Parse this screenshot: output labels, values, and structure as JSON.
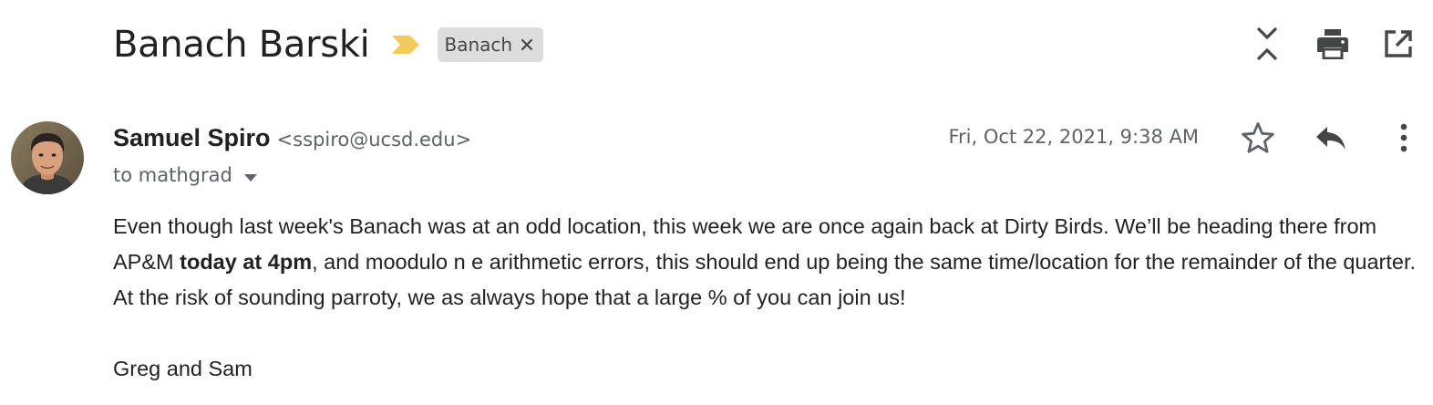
{
  "email": {
    "subject": "Banach Barski",
    "label": "Banach",
    "sender": {
      "name": "Samuel Spiro",
      "email": "<sspiro@ucsd.edu>"
    },
    "recipients": "to mathgrad",
    "date": "Fri, Oct 22, 2021, 9:38 AM",
    "body": {
      "part1": "Even though last week's Banach was at an odd location, this week we are once again back at Dirty Birds.  We’ll be heading there from AP&M ",
      "bold": "today at 4pm",
      "part2": ", and moodulo n e arithmetic errors, this should end up being the same time/location for the remainder of the quarter.  At the risk of sounding parroty, we as always hope that a large % of you can join us!"
    },
    "signature": "Greg and Sam"
  },
  "icons": {
    "importance": "importance-marker-icon",
    "label_remove": "close-icon",
    "collapse": "collapse-all-icon",
    "print": "print-icon",
    "new_window": "open-in-new-icon",
    "star": "star-icon",
    "reply": "reply-icon",
    "more": "more-vert-icon",
    "caret": "arrow-drop-down-icon"
  },
  "colors": {
    "importance": "#F2CB5C",
    "label_bg": "#DDDDDD",
    "secondary_text": "#5F6368",
    "icon": "#444746"
  }
}
